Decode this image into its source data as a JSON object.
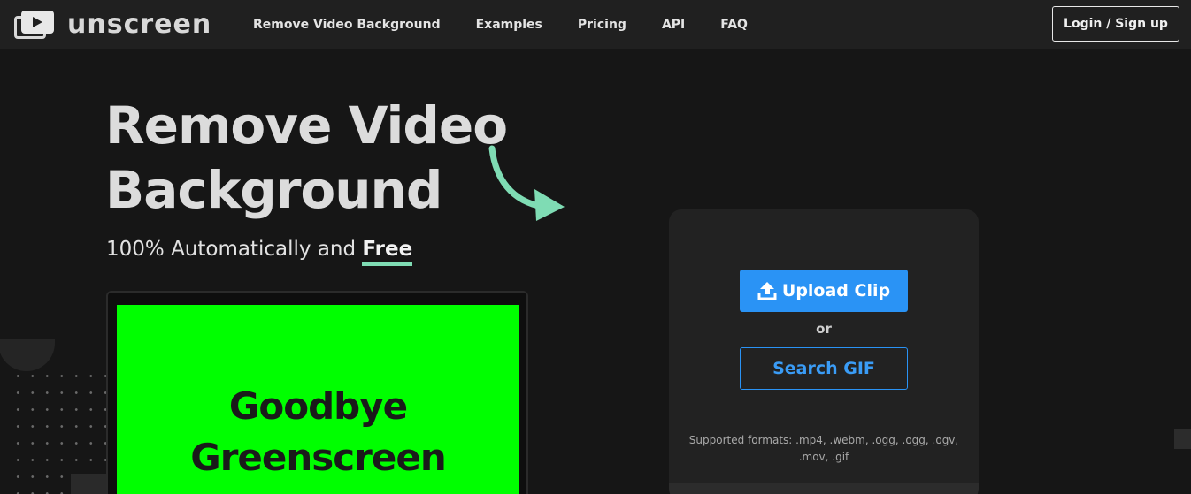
{
  "header": {
    "brand": "unscreen",
    "nav": [
      "Remove Video Background",
      "Examples",
      "Pricing",
      "API",
      "FAQ"
    ],
    "login_label": "Login / Sign up"
  },
  "hero": {
    "title_line1": "Remove Video",
    "title_line2": "Background",
    "subtitle_prefix": "100% Automatically and ",
    "subtitle_highlight": "Free"
  },
  "video": {
    "line1": "Goodbye",
    "line2": "Greenscreen",
    "bg_color": "#00ff00"
  },
  "upload": {
    "upload_label": "Upload Clip",
    "or_label": "or",
    "search_label": "Search GIF",
    "formats": "Supported formats: .mp4, .webm, .ogg, .ogg, .ogv, .mov, .gif"
  },
  "colors": {
    "accent": "#2a93f5",
    "highlight": "#7fdcb4",
    "background": "#161616",
    "header": "#202020"
  },
  "icons": {
    "logo": "play-icon",
    "upload": "upload-icon",
    "arrow": "curved-arrow-icon"
  }
}
